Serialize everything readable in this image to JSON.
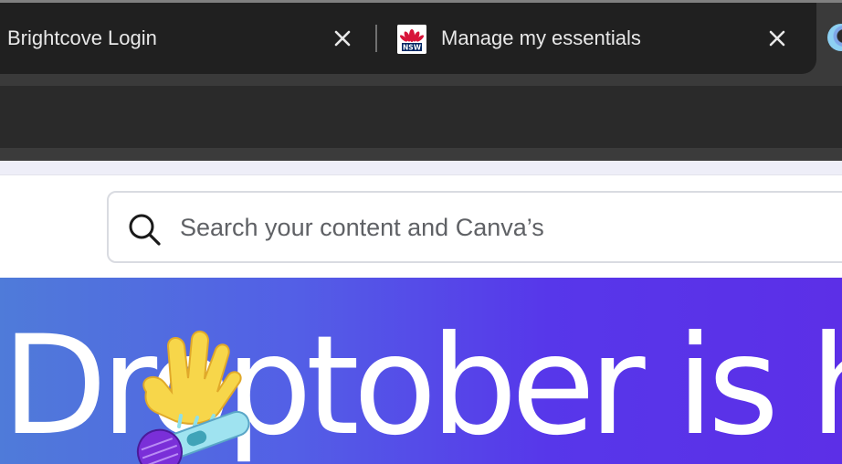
{
  "browser": {
    "tabs": [
      {
        "title": "Brightcove Login",
        "active": false
      },
      {
        "title": "Manage my essentials",
        "favicon": "nsw-waratah-logo-icon",
        "favicon_text": "NSW",
        "active": false
      }
    ],
    "close_icon": "close-icon",
    "next_tab_icon": "canva-logo-icon"
  },
  "search": {
    "placeholder": "Search your content and Canva’s",
    "value": "",
    "icon": "search-icon"
  },
  "banner": {
    "title": "Droptober is h",
    "art": "waving-hand-microphone-illustration",
    "gradient": [
      "#4f7bd9",
      "#5c2fe7"
    ]
  },
  "colors": {
    "tabbar": "#202020",
    "chrome": "#3a3a3a",
    "accent": "#5737ea"
  }
}
